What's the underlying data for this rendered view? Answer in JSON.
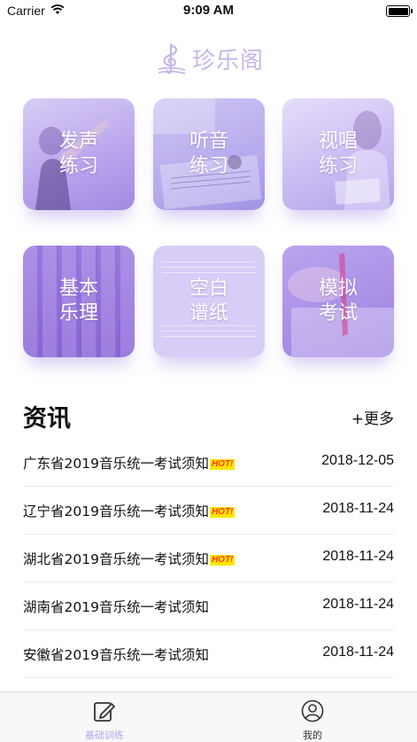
{
  "status_bar": {
    "carrier": "Carrier",
    "time": "9:09 AM"
  },
  "app": {
    "logo_text": "珍乐阁"
  },
  "grid": {
    "voice": "发声练习",
    "listening": "听音练习",
    "sight_singing": "视唱练习",
    "theory": "基本乐理",
    "blank_paper": "空白谱纸",
    "mock_exam": "模拟考试"
  },
  "news": {
    "title": "资讯",
    "more": "+更多",
    "hot_badge": "HOT!",
    "items": [
      {
        "text": "广东省2019音乐统一考试须知",
        "date": "2018-12-05",
        "hot": true
      },
      {
        "text": "辽宁省2019音乐统一考试须知",
        "date": "2018-11-24",
        "hot": true
      },
      {
        "text": "湖北省2019音乐统一考试须知",
        "date": "2018-11-24",
        "hot": true
      },
      {
        "text": "湖南省2019音乐统一考试须知",
        "date": "2018-11-24",
        "hot": false
      },
      {
        "text": "安徽省2019音乐统一考试须知",
        "date": "2018-11-24",
        "hot": false
      }
    ]
  },
  "tabs": {
    "home": "基础训练",
    "mine": "我的"
  },
  "colors": {
    "accent": "#b7a6ea",
    "card_purple": "#a28ae3",
    "hot_bg": "#ffe600",
    "hot_text": "#ff3a1a"
  }
}
